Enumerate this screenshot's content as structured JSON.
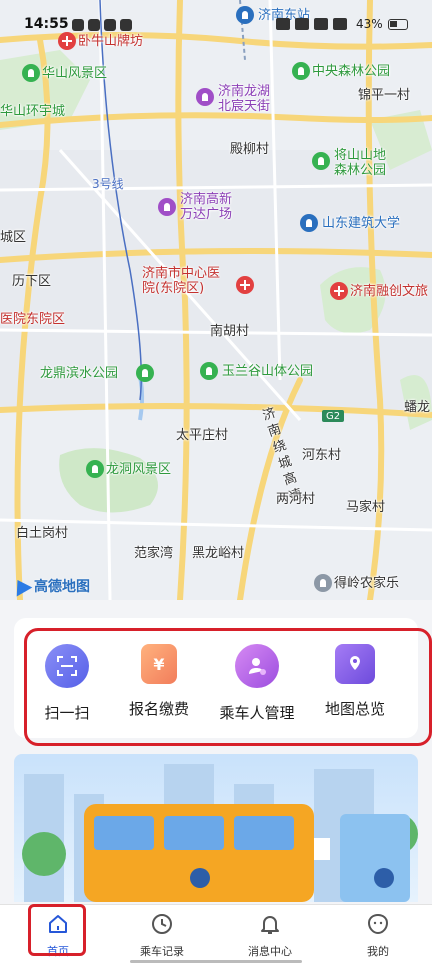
{
  "status_bar": {
    "time": "14:55",
    "battery": "43%"
  },
  "map": {
    "labels": {
      "jinan_east_station": "济南东站",
      "wonuishan": "卧牛山牌坊",
      "huashan": "华山风景区",
      "huanyu": "华山环宇城",
      "longhu": "济南龙湖\n北宸天街",
      "central_forest": "中央森林公园",
      "jinping": "锦平一村",
      "dianliu": "殿柳村",
      "jiangshan": "将山山地\n森林公园",
      "line3": "3号线",
      "wanda": "济南高新\n万达广场",
      "sd_jianzhu": "山东建筑大学",
      "chengqu": "城区",
      "lixia": "历下区",
      "central_hospital": "济南市中心医\n院(东院区)",
      "rongchuang": "济南融创文旅",
      "hospital_east": "医院东院区",
      "nanhu": "南胡村",
      "longding": "龙鼎滨水公园",
      "yulan": "玉兰谷山体公园",
      "g2": "G2",
      "panlong": "蟠龙",
      "raoegao": "济南绕城高速",
      "taiping": "太平庄村",
      "hedong": "河东村",
      "longdong": "龙洞风景区",
      "liangheb": "两河村",
      "majia": "马家村",
      "baitu": "白土岗村",
      "fanjia": "范家湾",
      "heilong": "黑龙峪村",
      "deling": "得岭农家乐",
      "amap": "高德地图"
    }
  },
  "quick_actions": [
    {
      "label": "扫一扫",
      "icon": "scan-icon"
    },
    {
      "label": "报名缴费",
      "icon": "payment-icon"
    },
    {
      "label": "乘车人管理",
      "icon": "rider-management-icon"
    },
    {
      "label": "地图总览",
      "icon": "map-overview-icon"
    }
  ],
  "tabs": [
    {
      "label": "首页",
      "icon": "home-icon",
      "active": true
    },
    {
      "label": "乘车记录",
      "icon": "clock-icon",
      "active": false
    },
    {
      "label": "消息中心",
      "icon": "bell-icon",
      "active": false
    },
    {
      "label": "我的",
      "icon": "profile-icon",
      "active": false
    }
  ],
  "colors": {
    "accent_blue": "#2657d8",
    "highlight_red": "#d7202a"
  }
}
